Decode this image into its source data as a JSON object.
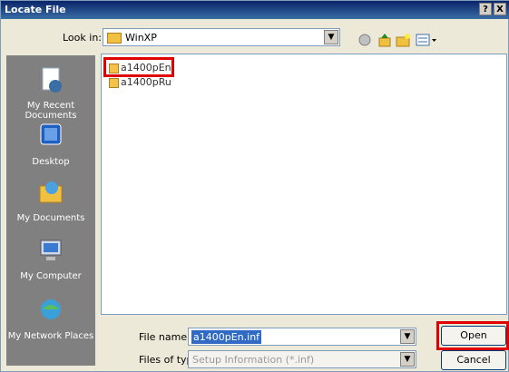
{
  "title": "Locate File",
  "title_buttons": {
    "help": "?",
    "close": "X"
  },
  "look_in": {
    "label": "Look in:",
    "value": "WinXP"
  },
  "places": [
    {
      "label": "My Recent Documents",
      "icon": "recent-documents-icon"
    },
    {
      "label": "Desktop",
      "icon": "desktop-icon"
    },
    {
      "label": "My Documents",
      "icon": "my-documents-icon"
    },
    {
      "label": "My Computer",
      "icon": "my-computer-icon"
    },
    {
      "label": "My Network Places",
      "icon": "network-places-icon"
    }
  ],
  "files": [
    {
      "name": "a1400pEn"
    },
    {
      "name": "a1400pRu"
    }
  ],
  "file_name": {
    "label": "File name:",
    "value": "a1400pEn.inf"
  },
  "file_type": {
    "label": "Files of type:",
    "value": "Setup Information (*.inf)"
  },
  "buttons": {
    "open": "Open",
    "cancel": "Cancel"
  },
  "colors": {
    "highlight": "#e00000",
    "titlebar": "#0a246a",
    "selection": "#316ac5"
  }
}
